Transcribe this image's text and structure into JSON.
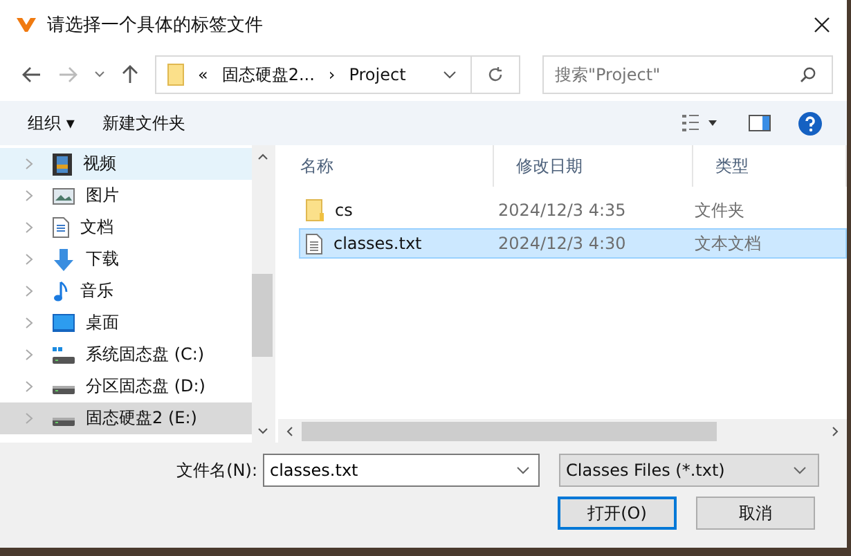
{
  "window": {
    "title": "请选择一个具体的标签文件"
  },
  "nav": {
    "breadcrumb": [
      "«",
      "固态硬盘2...",
      "›",
      "Project"
    ],
    "search": {
      "placeholder": "搜索\"Project\""
    }
  },
  "toolbar": {
    "items": [
      "组织 ▾",
      "新建文件夹"
    ]
  },
  "sidebar": {
    "items": [
      {
        "label": "视频",
        "kind": "video",
        "selected": false,
        "hovered": true
      },
      {
        "label": "图片",
        "kind": "picture",
        "selected": false,
        "hovered": false
      },
      {
        "label": "文档",
        "kind": "document",
        "selected": false,
        "hovered": false
      },
      {
        "label": "下载",
        "kind": "download",
        "selected": false,
        "hovered": false
      },
      {
        "label": "音乐",
        "kind": "music",
        "selected": false,
        "hovered": false
      },
      {
        "label": "桌面",
        "kind": "desktop",
        "selected": false,
        "hovered": false
      },
      {
        "label": "系统固态盘 (C:)",
        "kind": "system-drive",
        "selected": false,
        "hovered": false
      },
      {
        "label": "分区固态盘 (D:)",
        "kind": "drive",
        "selected": false,
        "hovered": false
      },
      {
        "label": "固态硬盘2 (E:)",
        "kind": "drive",
        "selected": true,
        "hovered": false
      }
    ]
  },
  "table": {
    "columns": [
      "名称",
      "修改日期",
      "类型"
    ],
    "rows": [
      {
        "kind": "folder",
        "name": "cs",
        "date": "2024/12/3 4:35",
        "type": "文件夹",
        "selected": false
      },
      {
        "kind": "file",
        "name": "classes.txt",
        "date": "2024/12/3 4:30",
        "type": "文本文档",
        "selected": true
      }
    ]
  },
  "footer": {
    "filename_label": "文件名(N):",
    "filename": "classes.txt",
    "filter": "Classes Files (*.txt)",
    "buttons": [
      {
        "label": "打开(O)",
        "kind": "primary"
      },
      {
        "label": "取消",
        "kind": "normal"
      }
    ]
  }
}
